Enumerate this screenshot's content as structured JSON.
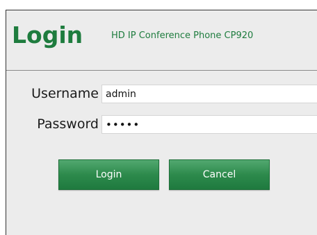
{
  "header": {
    "title": "Login",
    "subtitle": "HD IP Conference Phone CP920"
  },
  "form": {
    "username_label": "Username",
    "username_value": "admin",
    "password_label": "Password",
    "password_value": "admin"
  },
  "buttons": {
    "login_label": "Login",
    "cancel_label": "Cancel"
  },
  "colors": {
    "accent": "#1e7c3e",
    "button": "#2d8a4c",
    "background": "#ececec"
  }
}
